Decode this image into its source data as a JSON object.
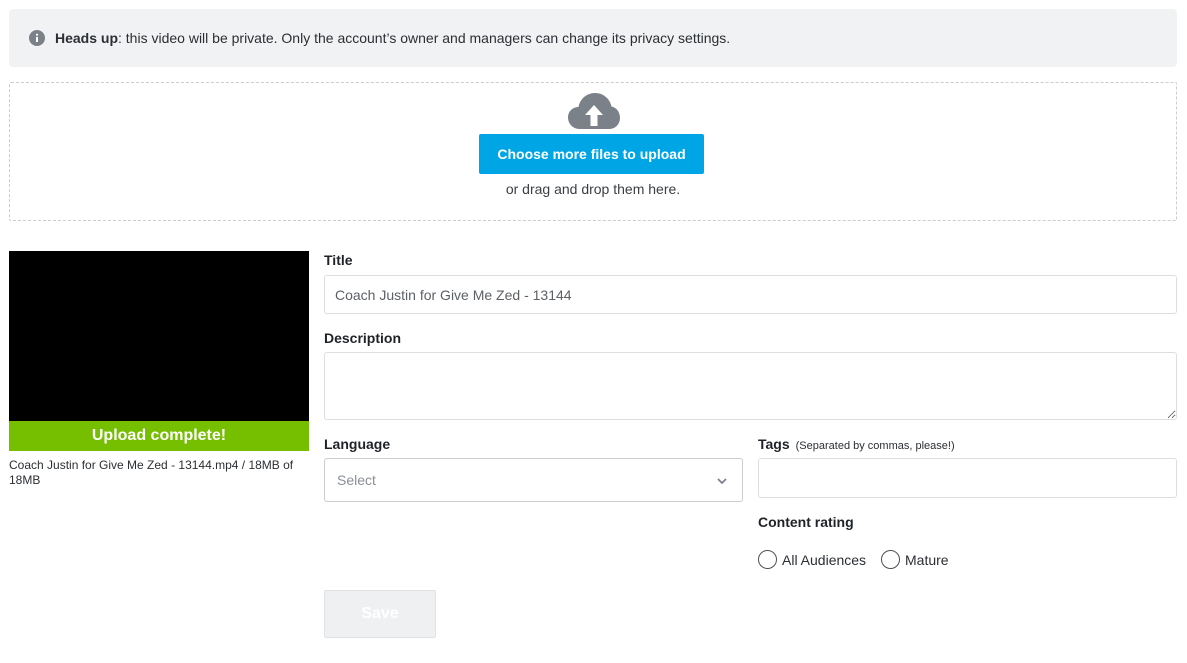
{
  "notice": {
    "icon": "info-icon",
    "bold": "Heads up",
    "text": ": this video will be private. Only the account’s owner and managers can change its privacy settings."
  },
  "upload": {
    "icon": "cloud-upload-icon",
    "button_label": "Choose more files to upload",
    "drag_text": "or drag and drop them here.",
    "accent": "#00a5e6"
  },
  "file": {
    "status": "Upload complete!",
    "info": "Coach Justin for Give Me Zed - 13144.mp4 / 18MB of 18MB",
    "progress": 1.0,
    "status_color": "#76be00"
  },
  "form": {
    "title_label": "Title",
    "title_value": "Coach Justin for Give Me Zed - 13144",
    "description_label": "Description",
    "description_value": "",
    "language_label": "Language",
    "language_value": "Select",
    "tags_label": "Tags",
    "tags_hint": "(Separated by commas, please!)",
    "tags_value": "",
    "content_rating_label": "Content rating",
    "rating_options": [
      "All Audiences",
      "Mature"
    ],
    "save_label": "Save"
  }
}
